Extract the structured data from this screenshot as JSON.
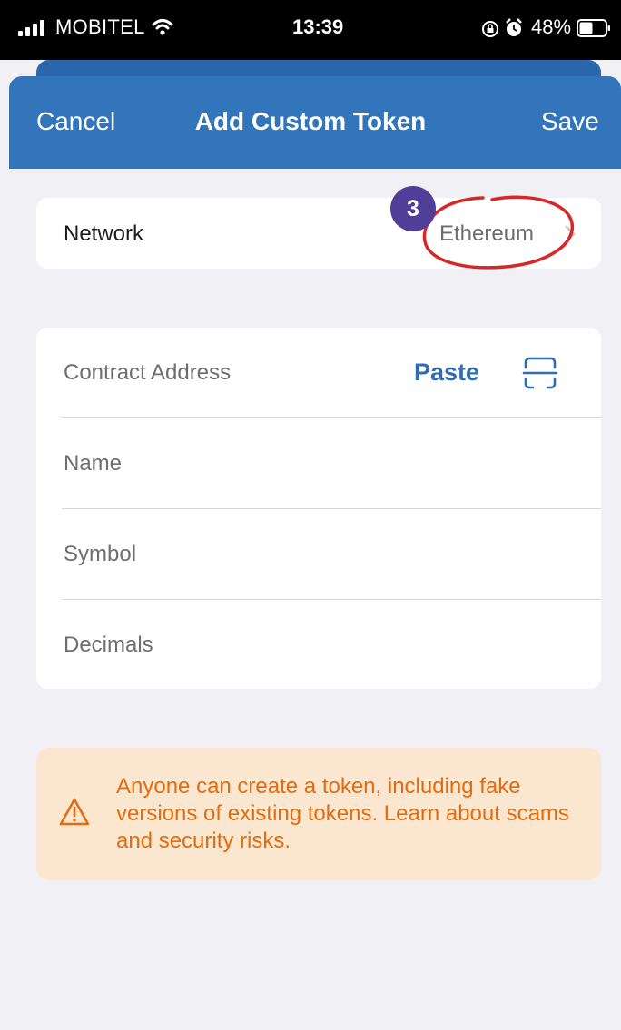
{
  "status_bar": {
    "carrier": "MOBITEL",
    "time": "13:39",
    "battery": "48%"
  },
  "header": {
    "cancel_label": "Cancel",
    "title": "Add Custom Token",
    "save_label": "Save"
  },
  "network": {
    "label": "Network",
    "value": "Ethereum"
  },
  "annotation": {
    "step": "3",
    "color": "#d62828",
    "badge_color": "#4f3f99"
  },
  "form": {
    "contract_address": {
      "placeholder": "Contract Address",
      "paste_label": "Paste"
    },
    "name": {
      "placeholder": "Name"
    },
    "symbol": {
      "placeholder": "Symbol"
    },
    "decimals": {
      "placeholder": "Decimals"
    }
  },
  "warning": {
    "text": "Anyone can create a token, including fake versions of existing tokens. Learn about scams and security risks."
  },
  "colors": {
    "header": "#3375bb",
    "accent": "#2f6db2",
    "warning_text": "#e36c0f",
    "warning_bg": "#fbe6cf"
  }
}
